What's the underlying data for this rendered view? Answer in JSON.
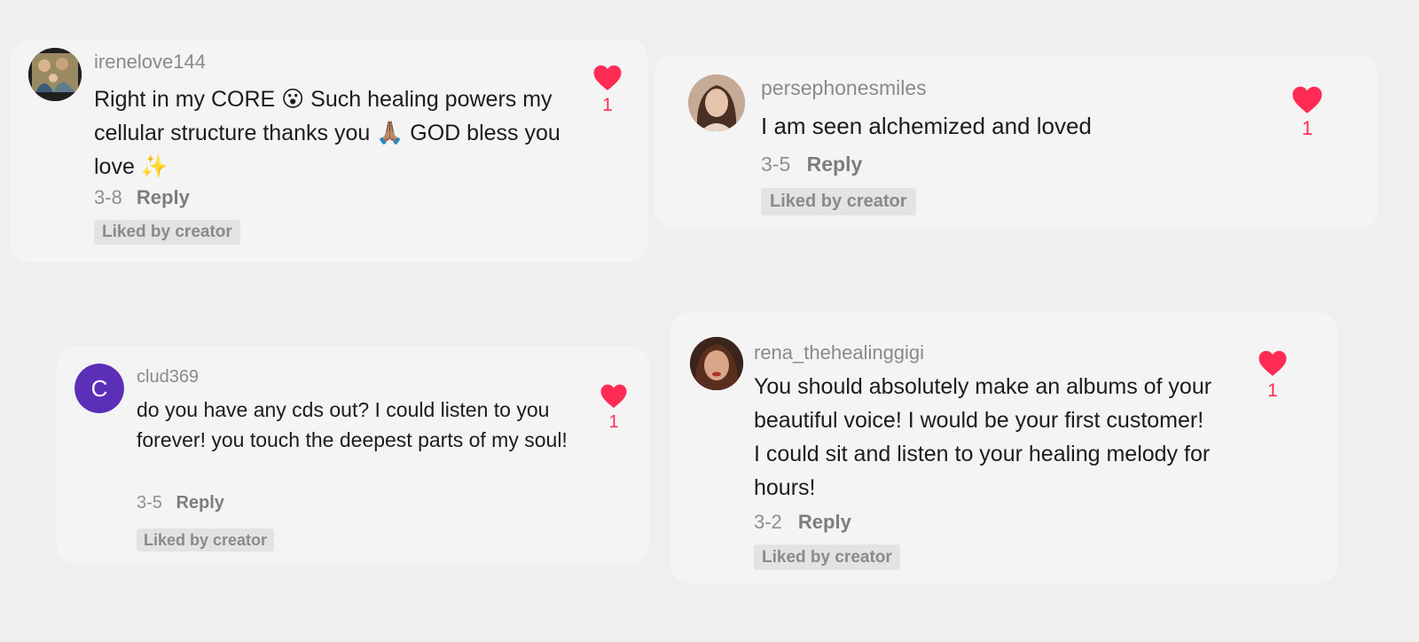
{
  "accent_color": "#fe2c55",
  "comments": [
    {
      "username": "irenelove144",
      "text_before": "Right in my CORE ",
      "emoji_1": "😮",
      "text_middle": " Such healing powers my cellular structure thanks you ",
      "emoji_2": "🙏🏽",
      "text_after": " GOD bless you love ",
      "emoji_3": "✨",
      "date": "3-8",
      "reply_label": "Reply",
      "liked_badge": "Liked by creator",
      "like_count": "1",
      "like_icon": "heart-icon"
    },
    {
      "username": "persephonesmiles",
      "text": "I am seen alchemized and loved",
      "date": "3-5",
      "reply_label": "Reply",
      "liked_badge": "Liked by creator",
      "like_count": "1",
      "like_icon": "heart-icon"
    },
    {
      "username": "clud369",
      "avatar_letter": "C",
      "avatar_color": "#5b2fb8",
      "text": "do you have any cds out? I could listen to you forever! you touch the deepest parts of my soul!",
      "date": "3-5",
      "reply_label": "Reply",
      "liked_badge": "Liked by creator",
      "like_count": "1",
      "like_icon": "heart-icon"
    },
    {
      "username": "rena_thehealinggigi",
      "text": "You should absolutely make an albums of your beautiful voice! I would be your first customer! I could sit and listen to your healing melody for hours!",
      "date": "3-2",
      "reply_label": "Reply",
      "liked_badge": "Liked by creator",
      "like_count": "1",
      "like_icon": "heart-icon"
    }
  ]
}
